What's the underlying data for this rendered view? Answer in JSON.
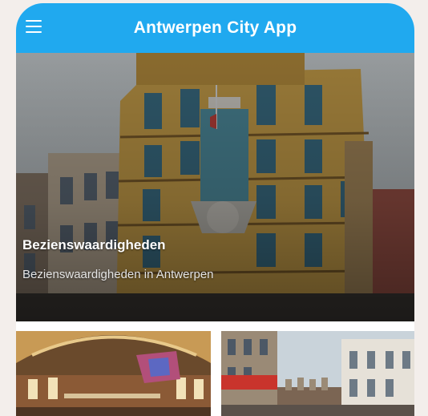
{
  "header": {
    "title": "Antwerpen City App",
    "menu_icon": "hamburger-menu-icon"
  },
  "hero": {
    "title": "Bezienswaardigheden",
    "subtitle": "Bezienswaardigheden in Antwerpen"
  },
  "colors": {
    "appbar": "#20a9ef",
    "background": "#f3eeeb",
    "text_on_image": "#ffffff"
  }
}
